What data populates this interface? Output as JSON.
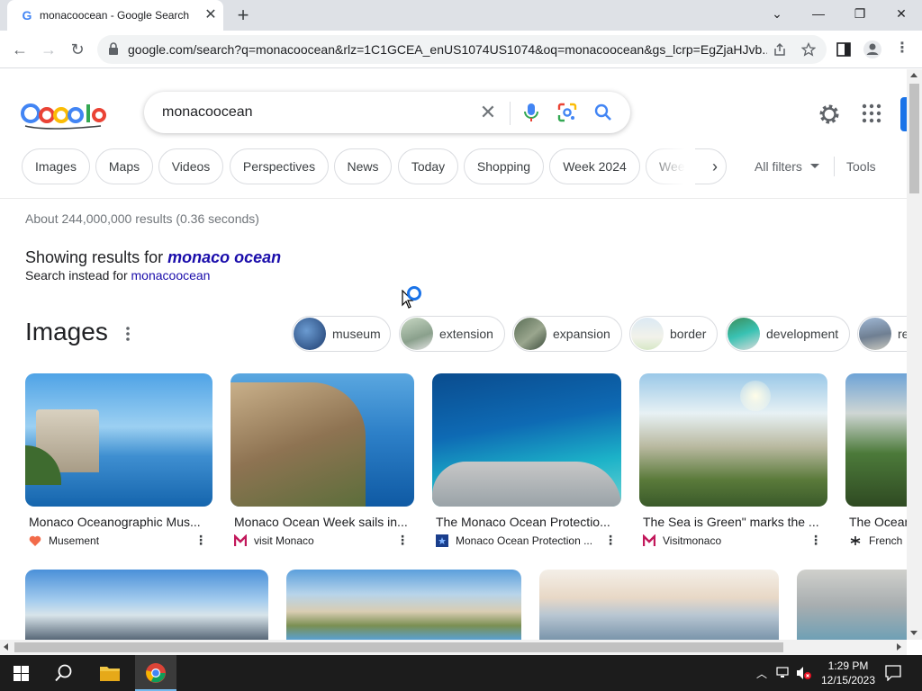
{
  "browser": {
    "tab_title": "monacoocean - Google Search",
    "tab_favicon": "G",
    "url": "google.com/search?q=monacoocean&rlz=1C1GCEA_enUS1074US1074&oq=monacoocean&gs_lcrp=EgZjaHJvb..."
  },
  "search": {
    "query": "monacoocean"
  },
  "chips": [
    "Images",
    "Maps",
    "Videos",
    "Perspectives",
    "News",
    "Today",
    "Shopping",
    "Week 2024",
    "Week"
  ],
  "filters": {
    "all_filters": "All filters",
    "tools": "Tools"
  },
  "results": {
    "stats": "About 244,000,000 results (0.36 seconds)",
    "showing_prefix": "Showing results for ",
    "showing_term": "monaco ocean",
    "instead_prefix": "Search instead for ",
    "instead_term": "monacoocean"
  },
  "images": {
    "title": "Images",
    "chips": [
      "museum",
      "extension",
      "expansion",
      "border",
      "development",
      "re"
    ],
    "cards": [
      {
        "caption": "Monaco Oceanographic Mus...",
        "source": "Musement"
      },
      {
        "caption": "Monaco Ocean Week sails in...",
        "source": "visit Monaco"
      },
      {
        "caption": "The Monaco Ocean Protectio...",
        "source": "Monaco Ocean Protection ..."
      },
      {
        "caption": "The Sea is Green\" marks the ...",
        "source": "Visitmonaco"
      },
      {
        "caption": "The Ocean",
        "source": "French"
      }
    ]
  },
  "taskbar": {
    "time": "1:29 PM",
    "date": "12/15/2023"
  },
  "colors": {
    "link": "#1a0dab",
    "accent": "#1a73e8"
  }
}
